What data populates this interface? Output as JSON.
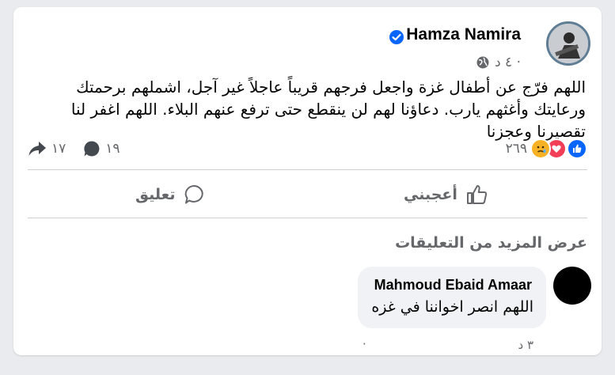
{
  "post": {
    "author": "Hamza Namira",
    "time": "٤ د ·",
    "text": "اللهم فرّج عن أطفال غزة واجعل فرجهم قريباً عاجلاً غير آجل، اشملهم برحمتك ورعايتك وأغثهم يارب. دعاؤنا لهم لن ينقطع حتى ترفع عنهم البلاء. اللهم اغفر لنا تقصيرنا وعجزنا",
    "reaction_count": "٢٦٩",
    "comment_count": "١٩",
    "share_count": "١٧"
  },
  "actions": {
    "like_label": "أعجبني",
    "comment_label": "تعليق"
  },
  "comments": {
    "more_label": "عرض المزيد من التعليقات",
    "items": [
      {
        "author": "Mahmoud Ebaid Amaar",
        "text": "اللهم انصر اخواننا في غزه",
        "time": "٣ د",
        "dot": "·"
      }
    ]
  },
  "colors": {
    "brand_blue": "#0866ff",
    "love_red": "#f33e58",
    "care_yellow": "#f7b125",
    "text_secondary": "#65676b"
  }
}
